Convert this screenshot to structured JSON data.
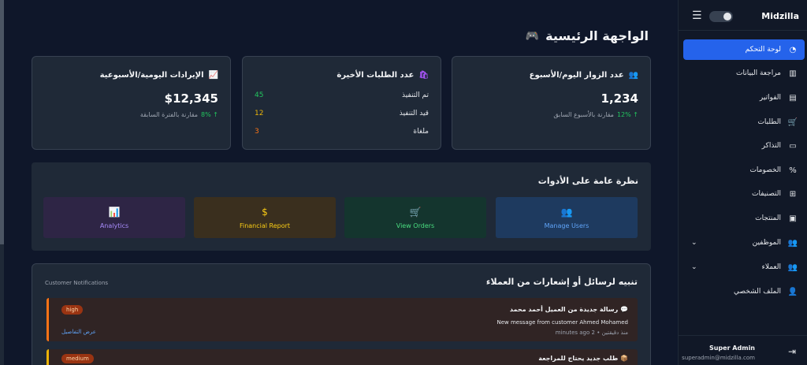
{
  "page": {
    "title": "الواجهة الرئيسية"
  },
  "stats": {
    "visitors": {
      "title": "عدد الزوار اليوم/الأسبوع",
      "value": "1,234",
      "change": "12%",
      "compare": "مقارنة بالأسبوع السابق"
    },
    "orders": {
      "title": "عدد الطلبات الأخيرة",
      "rows": [
        {
          "label": "تم التنفيذ",
          "value": "45",
          "color": "#22c55e"
        },
        {
          "label": "قيد التنفيذ",
          "value": "12",
          "color": "#eab308"
        },
        {
          "label": "ملغاة",
          "value": "3",
          "color": "#f97316"
        }
      ]
    },
    "revenue": {
      "title": "الإيرادات اليومية/الأسبوعية",
      "value": "$12,345",
      "change": "8%",
      "compare": "مقارنة بالفترة السابقة"
    }
  },
  "tools": {
    "title": "نظرة عامة على الأدوات",
    "buttons": [
      {
        "label": "Manage Users",
        "icon": "users-icon",
        "bg": "#1e3a5f",
        "fg": "#60a5fa"
      },
      {
        "label": "View Orders",
        "icon": "cart-icon",
        "bg": "#14352e",
        "fg": "#4ade80"
      },
      {
        "label": "Financial Report",
        "icon": "dollar-icon",
        "bg": "#3a2f1e",
        "fg": "#facc15"
      },
      {
        "label": "Analytics",
        "icon": "chart-icon",
        "bg": "#2e2545",
        "fg": "#a78bfa"
      }
    ]
  },
  "notifications": {
    "title": "تنبيه لرسائل أو إشعارات من العملاء",
    "subtitle": "Customer Notifications",
    "items": [
      {
        "title": "رسالة جديدة من العميل أحمد محمد",
        "title_en": "New message from customer Ahmed Mohamed",
        "time": "منذ دقيقتين • 2 minutes ago",
        "priority": "high",
        "link": "عرض التفاصيل"
      },
      {
        "title": "طلب جديد يحتاج للمراجعة",
        "priority": "medium"
      }
    ]
  },
  "sidebar": {
    "brand": "Midzilla",
    "items": [
      {
        "label": "لوحة التحكم",
        "icon": "dashboard-icon",
        "active": true
      },
      {
        "label": "مراجعة البيانات",
        "icon": "bar-chart-icon"
      },
      {
        "label": "الفواتير",
        "icon": "invoice-icon"
      },
      {
        "label": "الطلبات",
        "icon": "cart-icon"
      },
      {
        "label": "التذاكر",
        "icon": "ticket-icon"
      },
      {
        "label": "الخصومات",
        "icon": "percent-icon"
      },
      {
        "label": "التصنيفات",
        "icon": "sitemap-icon"
      },
      {
        "label": "المنتجات",
        "icon": "box-icon"
      },
      {
        "label": "الموظفين",
        "icon": "users-icon",
        "expandable": true
      },
      {
        "label": "العملاء",
        "icon": "users-icon",
        "expandable": true
      },
      {
        "label": "الملف الشخصي",
        "icon": "user-icon"
      }
    ],
    "user": {
      "name": "Super Admin",
      "email": "superadmin@midzilla.com"
    }
  }
}
